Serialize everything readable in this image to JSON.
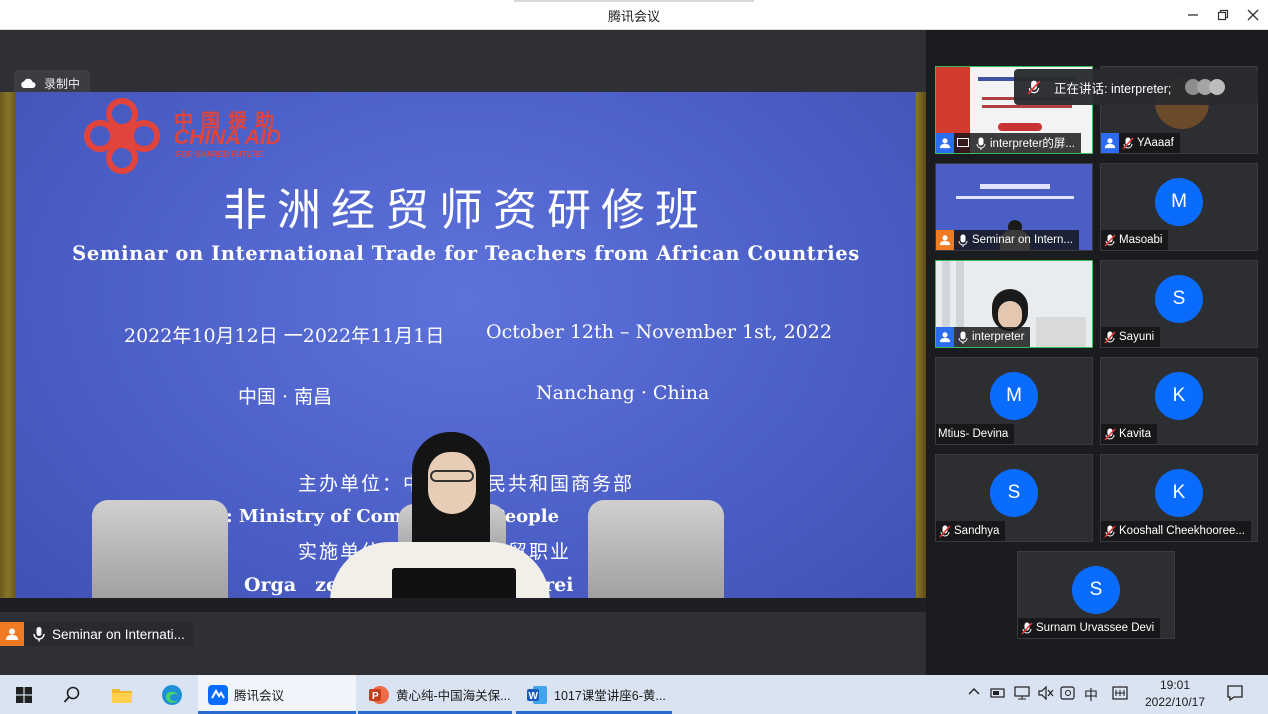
{
  "window": {
    "title": "腾讯会议",
    "minimize_icon": "minimize-icon",
    "restore_icon": "restore-icon",
    "close_icon": "close-icon"
  },
  "recording": {
    "label": "录制中",
    "icon": "cloud-icon"
  },
  "banner": {
    "logo_cn": "中国援助",
    "logo_en": "CHINA AID",
    "logo_sub": "FOR SHARED FUTURE",
    "title_cn": "非洲经贸师资研修班",
    "title_en": "Seminar on International Trade for Teachers from African Countries",
    "date_cn": "2022年10月12日 一2022年11月1日",
    "date_en": "October 12th – November 1st, 2022",
    "location_cn": "中国 · 南昌",
    "location_en": "Nanchang · China",
    "host_cn": "主办单位：中　　　民共和国商务部",
    "host_en": ": Ministry of Com　　　　　People　　　of China",
    "organizer_cn": "实施单位　　　　　　贸职业",
    "organizer_en": "Orga　zer　　　　　　　　　Forei"
  },
  "main_label": {
    "name": "Seminar on Internati...",
    "colors": {
      "user_badge": "#f07b22"
    }
  },
  "speaking": {
    "label": "正在讲话: interpreter;"
  },
  "participants": [
    {
      "name": "interpreter的屏...",
      "avatar": "",
      "video": "screen-share"
    },
    {
      "name": "YAaaaf",
      "avatar": "",
      "video": "camera"
    },
    {
      "name": "Seminar on Intern...",
      "avatar": "",
      "video": "camera"
    },
    {
      "name": "Masoabi",
      "avatar": "M",
      "video": "none"
    },
    {
      "name": "interpreter",
      "avatar": "",
      "video": "camera"
    },
    {
      "name": "Sayuni",
      "avatar": "S",
      "video": "none"
    },
    {
      "name": "Mtius- Devina",
      "avatar": "M",
      "video": "none"
    },
    {
      "name": "Kavita",
      "avatar": "K",
      "video": "none"
    },
    {
      "name": "Sandhya",
      "avatar": "S",
      "video": "none"
    },
    {
      "name": "Kooshall Cheekhooree...",
      "avatar": "K",
      "video": "none"
    },
    {
      "name": "Surnam Urvassee Devi",
      "avatar": "S",
      "video": "none"
    }
  ],
  "taskbar": {
    "apps": [
      {
        "label": "腾讯会议",
        "icon": "tencent-meeting-icon"
      },
      {
        "label": "黄心纯-中国海关保...",
        "icon": "powerpoint-icon"
      },
      {
        "label": "1017课堂讲座6-黄...",
        "icon": "word-icon"
      }
    ],
    "ime": "中",
    "time": "19:01",
    "date": "2022/10/17"
  },
  "colors": {
    "accent": "#0a6cff",
    "active_speaker": "#3bbb5c",
    "brand_red": "#e0443c"
  }
}
